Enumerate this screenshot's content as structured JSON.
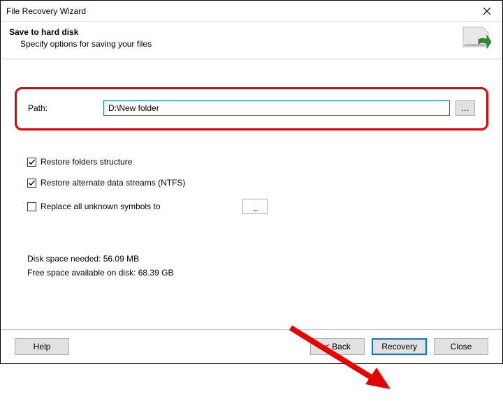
{
  "window": {
    "title": "File Recovery Wizard"
  },
  "header": {
    "title": "Save to hard disk",
    "subtitle": "Specify options for saving your files"
  },
  "path": {
    "label": "Path:",
    "value": "D:\\New folder",
    "browse": "…"
  },
  "options": {
    "restoreFolders": {
      "label": "Restore folders structure",
      "checked": true
    },
    "restoreADS": {
      "label": "Restore alternate data streams (NTFS)",
      "checked": true
    },
    "replaceUnknown": {
      "label": "Replace all unknown symbols to",
      "checked": false,
      "value": "_"
    }
  },
  "diskInfo": {
    "needed": "Disk space needed: 56.09 MB",
    "free": "Free space available on disk: 68.39 GB"
  },
  "buttons": {
    "help": "Help",
    "back": "< Back",
    "recovery": "Recovery",
    "close": "Close"
  }
}
